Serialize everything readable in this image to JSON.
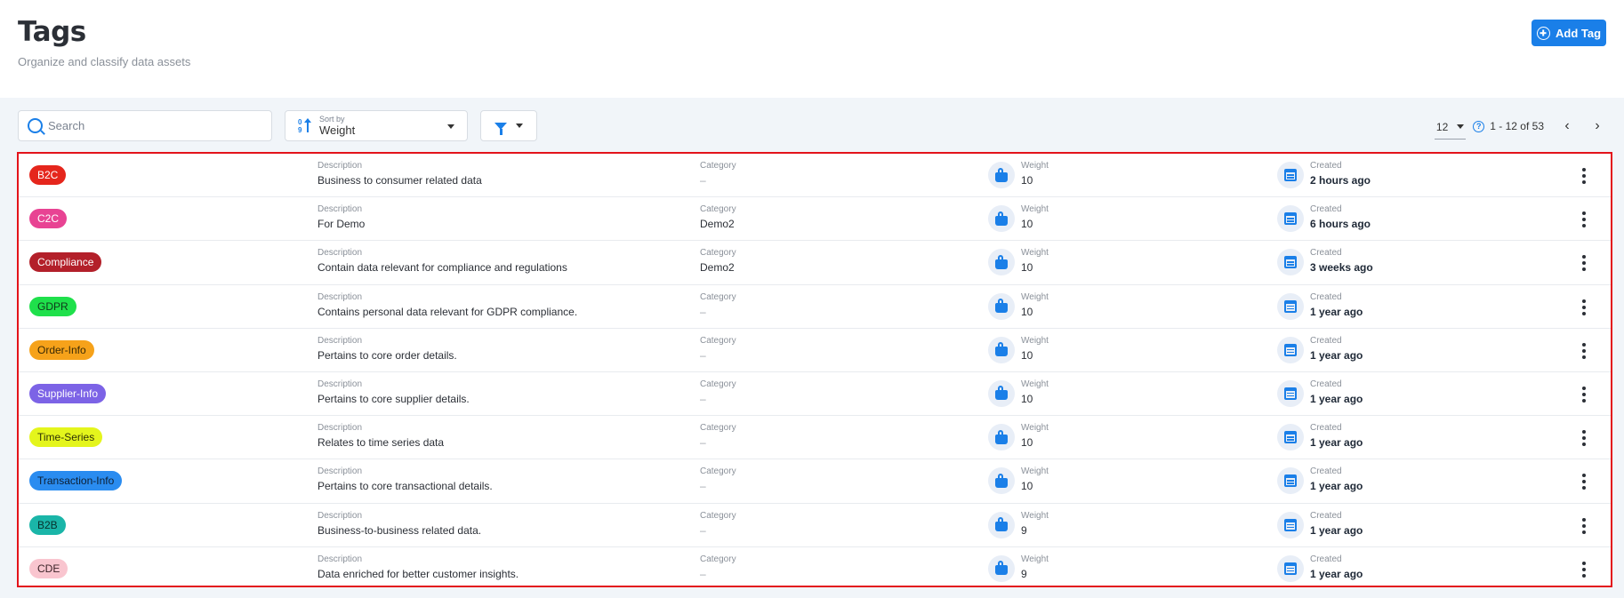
{
  "header": {
    "title": "Tags",
    "subtitle": "Organize and classify data assets",
    "add_button": "Add Tag"
  },
  "toolbar": {
    "search_placeholder": "Search",
    "sort_label": "Sort by",
    "sort_value": "Weight",
    "page_size": "12",
    "range": "1 - 12 of 53",
    "help": "?",
    "prev": "‹",
    "next": "›"
  },
  "labels": {
    "description": "Description",
    "category": "Category",
    "weight": "Weight",
    "created": "Created"
  },
  "rows": [
    {
      "tag": "B2C",
      "bg": "#e5261c",
      "fg": "#ffffff",
      "description": "Business to consumer related data",
      "category": "–",
      "weight": "10",
      "created": "2 hours ago"
    },
    {
      "tag": "C2C",
      "bg": "#e84393",
      "fg": "#ffffff",
      "description": "For Demo",
      "category": "Demo2",
      "weight": "10",
      "created": "6 hours ago"
    },
    {
      "tag": "Compliance",
      "bg": "#b3202a",
      "fg": "#ffffff",
      "description": "Contain data relevant for compliance and regulations",
      "category": "Demo2",
      "weight": "10",
      "created": "3 weeks ago"
    },
    {
      "tag": "GDPR",
      "bg": "#1fe04b",
      "fg": "#10381a",
      "description": "Contains personal data relevant for GDPR compliance.",
      "category": "–",
      "weight": "10",
      "created": "1 year ago"
    },
    {
      "tag": "Order-Info",
      "bg": "#f6a21a",
      "fg": "#3a2a05",
      "description": "Pertains to core order details.",
      "category": "–",
      "weight": "10",
      "created": "1 year ago"
    },
    {
      "tag": "Supplier-Info",
      "bg": "#7c63e6",
      "fg": "#ffffff",
      "description": "Pertains to core supplier details.",
      "category": "–",
      "weight": "10",
      "created": "1 year ago"
    },
    {
      "tag": "Time-Series",
      "bg": "#e4f51c",
      "fg": "#2f3306",
      "description": "Relates to time series data",
      "category": "–",
      "weight": "10",
      "created": "1 year ago"
    },
    {
      "tag": "Transaction-Info",
      "bg": "#2a8cf0",
      "fg": "#0d1f33",
      "description": "Pertains to core transactional details.",
      "category": "–",
      "weight": "10",
      "created": "1 year ago"
    },
    {
      "tag": "B2B",
      "bg": "#1ab5a8",
      "fg": "#07302c",
      "description": "Business-to-business related data.",
      "category": "–",
      "weight": "9",
      "created": "1 year ago"
    },
    {
      "tag": "CDE",
      "bg": "#f9c5cf",
      "fg": "#3a2227",
      "description": "Data enriched for better customer insights.",
      "category": "–",
      "weight": "9",
      "created": "1 year ago"
    }
  ]
}
